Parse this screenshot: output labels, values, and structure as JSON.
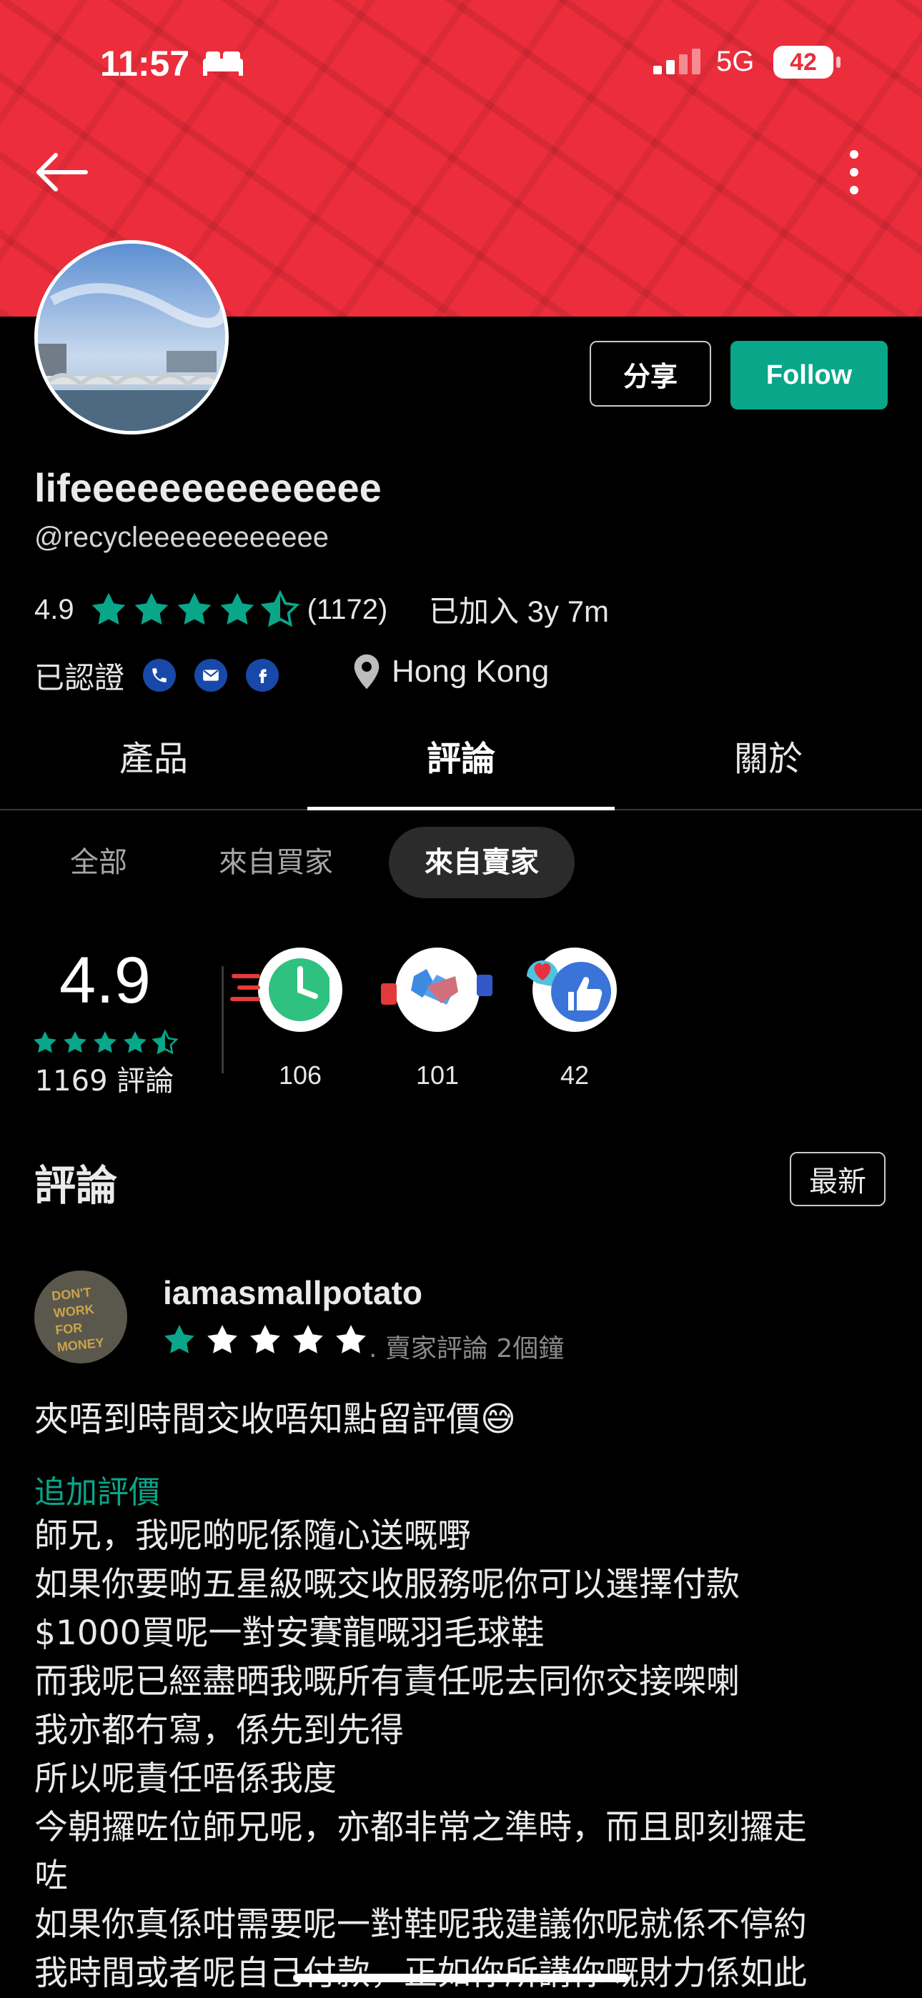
{
  "status_bar": {
    "time": "11:57",
    "network": "5G",
    "battery": "42"
  },
  "profile": {
    "name": "lifeeeeeeeeeeeeee",
    "handle": "@recycleeeeeeeeeeee",
    "rating": "4.9",
    "rating_count": "(1172)",
    "joined": "已加入 3y 7m",
    "verified_label": "已認證",
    "location": "Hong Kong",
    "share_label": "分享",
    "follow_label": "Follow"
  },
  "tabs": [
    "產品",
    "評論",
    "關於"
  ],
  "active_tab": "評論",
  "filters": [
    "全部",
    "來自買家",
    "來自賣家"
  ],
  "active_filter": "來自賣家",
  "summary": {
    "score": "4.9",
    "review_count": "1169 評論",
    "metrics": [
      {
        "icon": "fast-clock-icon",
        "value": "106"
      },
      {
        "icon": "handshake-icon",
        "value": "101"
      },
      {
        "icon": "heart-thumbs-up-icon",
        "value": "42"
      }
    ]
  },
  "reviews_section": {
    "title": "評論",
    "sort_label": "最新"
  },
  "review": {
    "username": "iamasmallpotato",
    "avatar_text": "DON'T WORK FOR MONEY",
    "stars": 1,
    "meta": ". 賣家評論  2個鐘",
    "text": "夾唔到時間交收唔知點留評價😅",
    "additional_label": "追加評價",
    "additional_lines": [
      "師兄，我呢啲呢係隨心送嘅嘢",
      "如果你要啲五星級嘅交收服務呢你可以選擇付款",
      "$1000買呢一對安賽龍嘅羽毛球鞋",
      "而我呢已經盡晒我嘅所有責任呢去同你交接㗎喇",
      "我亦都冇寫，係先到先得",
      "所以呢責任唔係我度",
      "今朝攞咗位師兄呢，亦都非常之準時，而且即刻攞走",
      "咗",
      "如果你真係咁需要呢一對鞋呢我建議你呢就係不停約",
      "我時間或者呢自己付款，正如你所講你嘅財力係如此"
    ]
  },
  "colors": {
    "banner": "#ec2d3b",
    "accent": "#09a68a",
    "background": "#000000"
  }
}
